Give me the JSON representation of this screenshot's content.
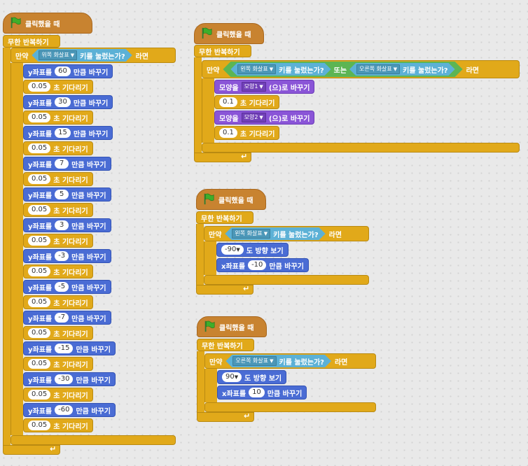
{
  "scripts": [
    {
      "hat": "클릭했을 때",
      "forever": "무한 반복하기",
      "if_prefix": "만약",
      "if_suffix": "라면",
      "key": "위쪽 화살표",
      "key_pressed": "키를 눌렀는가?",
      "steps": [
        {
          "type": "move",
          "pre": "y좌표를",
          "val": "60",
          "post": "만큼 바꾸기"
        },
        {
          "type": "wait",
          "val": "0.05",
          "post": "초 기다리기"
        },
        {
          "type": "move",
          "pre": "y좌표를",
          "val": "30",
          "post": "만큼 바꾸기"
        },
        {
          "type": "wait",
          "val": "0.05",
          "post": "초 기다리기"
        },
        {
          "type": "move",
          "pre": "y좌표를",
          "val": "15",
          "post": "만큼 바꾸기"
        },
        {
          "type": "wait",
          "val": "0.05",
          "post": "초 기다리기"
        },
        {
          "type": "move",
          "pre": "y좌표를",
          "val": "7",
          "post": "만큼 바꾸기"
        },
        {
          "type": "wait",
          "val": "0.05",
          "post": "초 기다리기"
        },
        {
          "type": "move",
          "pre": "y좌표를",
          "val": "5",
          "post": "만큼 바꾸기"
        },
        {
          "type": "wait",
          "val": "0.05",
          "post": "초 기다리기"
        },
        {
          "type": "move",
          "pre": "y좌표를",
          "val": "3",
          "post": "만큼 바꾸기"
        },
        {
          "type": "wait",
          "val": "0.05",
          "post": "초 기다리기"
        },
        {
          "type": "move",
          "pre": "y좌표를",
          "val": "-3",
          "post": "만큼 바꾸기"
        },
        {
          "type": "wait",
          "val": "0.05",
          "post": "초 기다리기"
        },
        {
          "type": "move",
          "pre": "y좌표를",
          "val": "-5",
          "post": "만큼 바꾸기"
        },
        {
          "type": "wait",
          "val": "0.05",
          "post": "초 기다리기"
        },
        {
          "type": "move",
          "pre": "y좌표를",
          "val": "-7",
          "post": "만큼 바꾸기"
        },
        {
          "type": "wait",
          "val": "0.05",
          "post": "초 기다리기"
        },
        {
          "type": "move",
          "pre": "y좌표를",
          "val": "-15",
          "post": "만큼 바꾸기"
        },
        {
          "type": "wait",
          "val": "0.05",
          "post": "초 기다리기"
        },
        {
          "type": "move",
          "pre": "y좌표를",
          "val": "-30",
          "post": "만큼 바꾸기"
        },
        {
          "type": "wait",
          "val": "0.05",
          "post": "초 기다리기"
        },
        {
          "type": "move",
          "pre": "y좌표를",
          "val": "-60",
          "post": "만큼 바꾸기"
        },
        {
          "type": "wait",
          "val": "0.05",
          "post": "초 기다리기"
        }
      ]
    },
    {
      "hat": "클릭했을 때",
      "forever": "무한 반복하기",
      "if_prefix": "만약",
      "if_suffix": "라면",
      "key_left": "왼쪽 화살표",
      "key_right": "오른쪽 화살표",
      "key_pressed": "키를 눌렀는가?",
      "or": "또는",
      "steps": [
        {
          "type": "costume",
          "pre": "모양을",
          "val": "모양1",
          "post": "(으)로 바꾸기"
        },
        {
          "type": "wait",
          "val": "0.1",
          "post": "초 기다리기"
        },
        {
          "type": "costume",
          "pre": "모양을",
          "val": "모양2",
          "post": "(으)로 바꾸기"
        },
        {
          "type": "wait",
          "val": "0.1",
          "post": "초 기다리기"
        }
      ]
    },
    {
      "hat": "클릭했을 때",
      "forever": "무한 반복하기",
      "if_prefix": "만약",
      "if_suffix": "라면",
      "key": "왼쪽 화살표",
      "key_pressed": "키를 눌렀는가?",
      "steps": [
        {
          "type": "point",
          "val": "-90",
          "post": "도 방향 보기"
        },
        {
          "type": "movex",
          "pre": "x좌표를",
          "val": "-10",
          "post": "만큼 바꾸기"
        }
      ]
    },
    {
      "hat": "클릭했을 때",
      "forever": "무한 반복하기",
      "if_prefix": "만약",
      "if_suffix": "라면",
      "key": "오른쪽 화살표",
      "key_pressed": "키를 눌렀는가?",
      "steps": [
        {
          "type": "point",
          "val": "90",
          "post": "도 방향 보기"
        },
        {
          "type": "movex",
          "pre": "x좌표를",
          "val": "10",
          "post": "만큼 바꾸기"
        }
      ]
    }
  ],
  "colors": {
    "events": "#c88330",
    "control": "#e1a91a",
    "motion": "#4a6cd4",
    "looks": "#8a55d7",
    "sensing": "#5cb1d6",
    "operators": "#5cb553"
  },
  "icons": {
    "flag": "green-flag-icon",
    "loop": "loop-arrow-icon",
    "dropdown": "dropdown-arrow-icon"
  },
  "loop_glyph": "↵",
  "dropdown_glyph": "▼"
}
